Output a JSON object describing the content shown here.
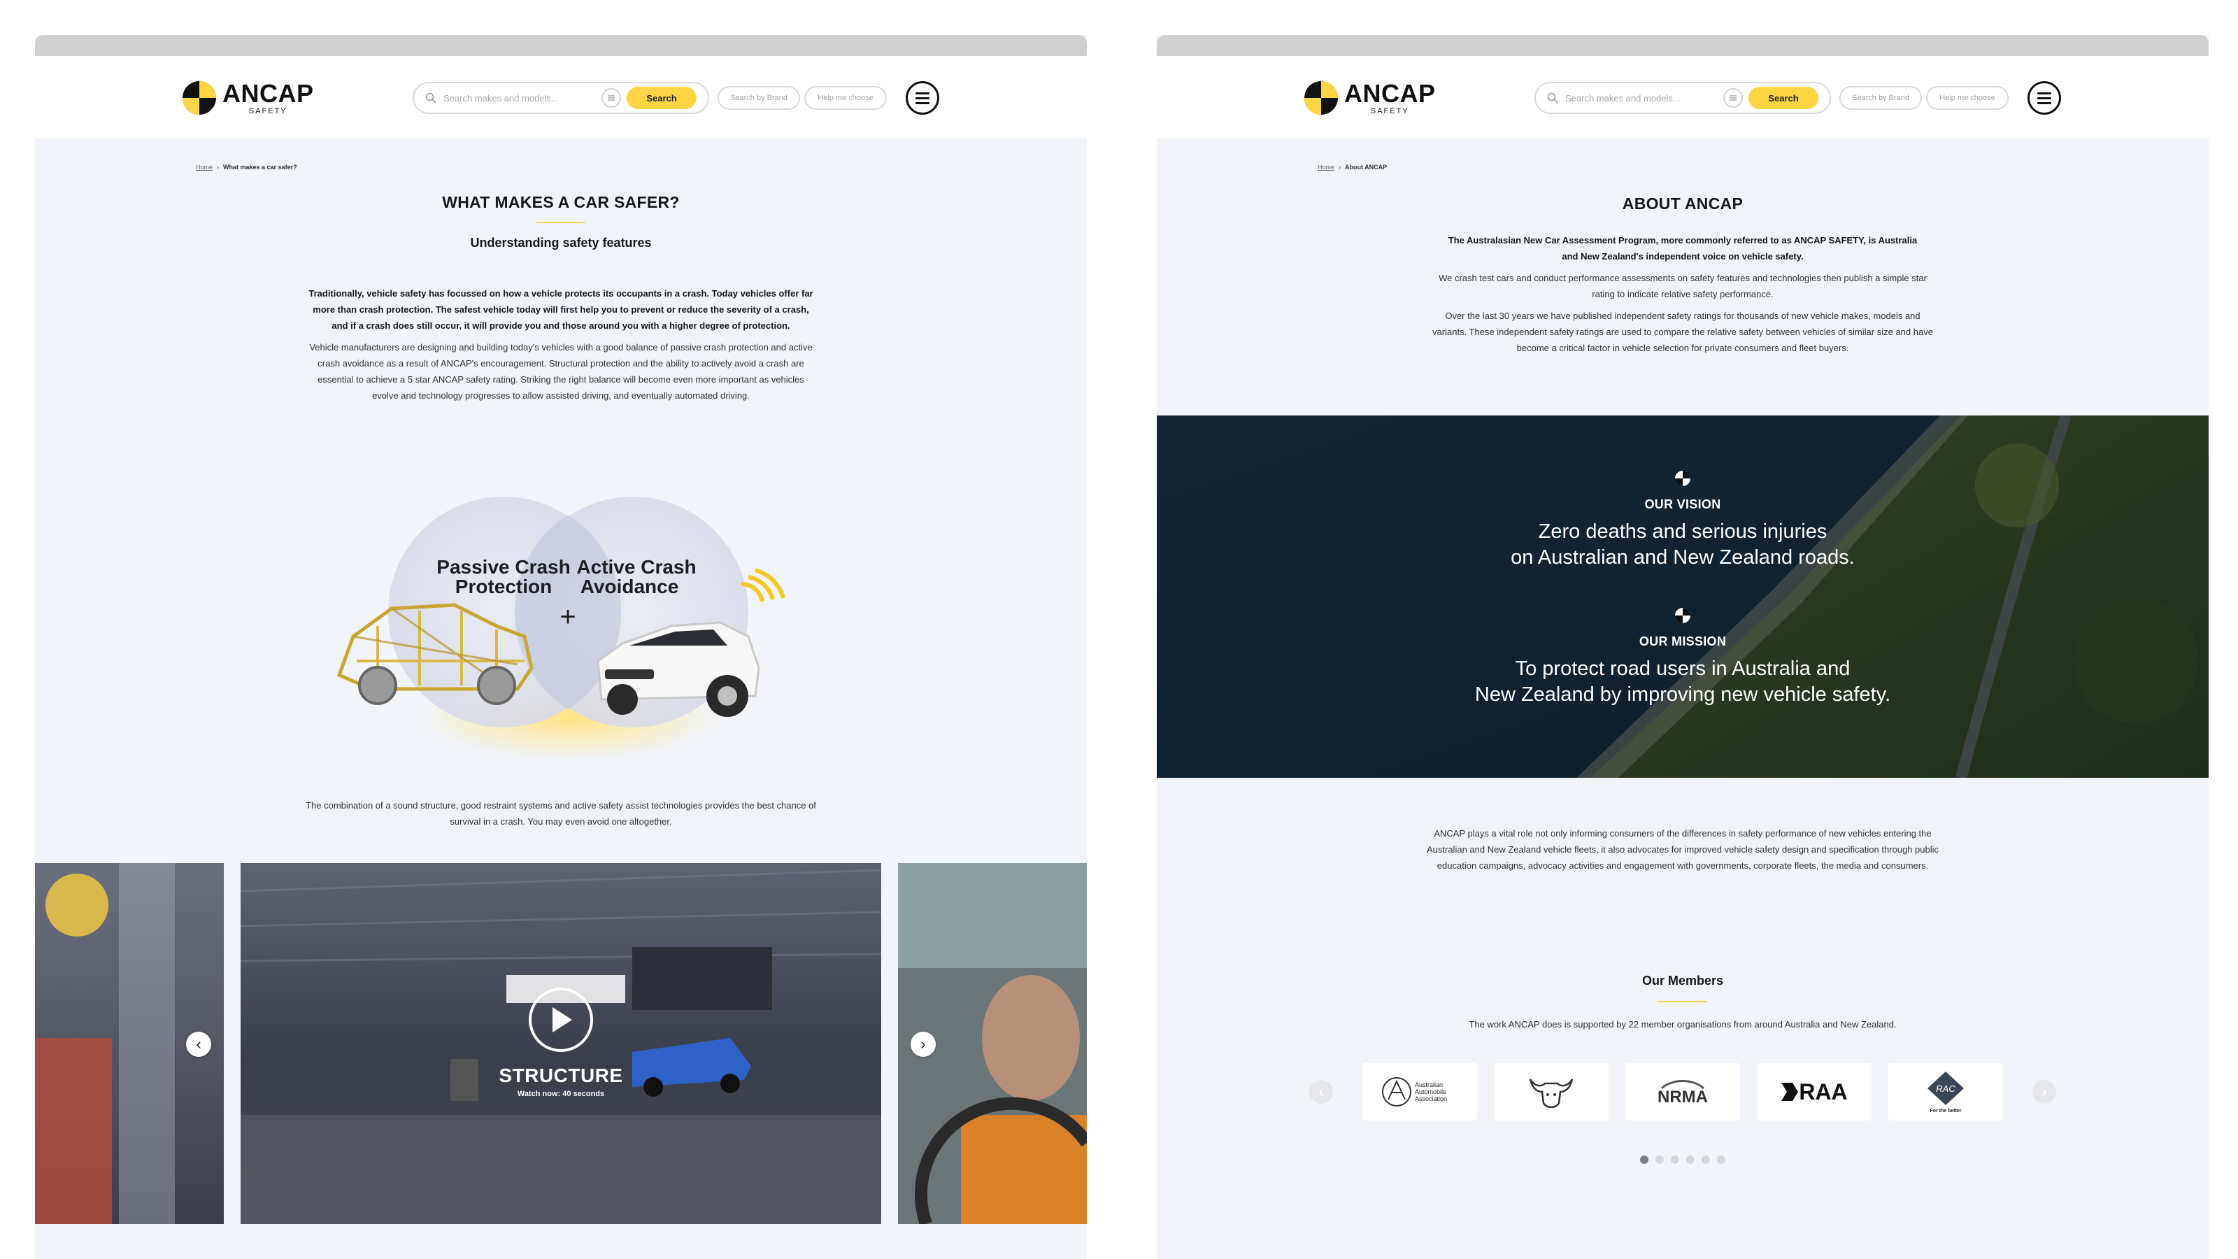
{
  "brand": {
    "name": "ANCAP",
    "sub": "SAFETY",
    "accent": "#ffd546"
  },
  "header": {
    "search_placeholder": "Search makes and models...",
    "search_button": "Search",
    "search_by_brand": "Search by Brand",
    "help_me_choose": "Help me choose"
  },
  "left_page": {
    "breadcrumb": {
      "home": "Home",
      "current": "What makes a car safer?"
    },
    "title": "WHAT MAKES A CAR SAFER?",
    "subtitle": "Understanding safety features",
    "intro_bold": "Traditionally, vehicle safety has focussed on how a vehicle protects its occupants in a crash. Today vehicles offer far more than crash protection. The safest vehicle today will first help you to prevent or reduce the severity of a crash, and if a crash does still occur, it will provide you and those around you with a higher degree of protection.",
    "intro_body": "Vehicle manufacturers are designing and building today's vehicles with a good balance of passive crash protection and active crash avoidance as a result of ANCAP's encouragement. Structural protection and the ability to actively avoid a crash are essential to achieve a 5 star ANCAP safety rating. Striking the right balance will become even more important as vehicles evolve and technology progresses to allow assisted driving, and eventually automated driving.",
    "venn": {
      "left_line1": "Passive Crash",
      "left_line2": "Protection",
      "plus": "+",
      "right_line1": "Active Crash",
      "right_line2": "Avoidance"
    },
    "combination_text": "The combination of a sound structure, good restraint systems and active safety assist technologies provides the best chance of survival in a crash. You may even avoid one altogether.",
    "video": {
      "title": "STRUCTURE",
      "duration": "Watch now: 40 seconds"
    }
  },
  "right_page": {
    "breadcrumb": {
      "home": "Home",
      "current": "About ANCAP"
    },
    "title": "ABOUT ANCAP",
    "intro_bold": "The Australasian New Car Assessment Program, more commonly referred to as ANCAP SAFETY, is Australia and New Zealand's independent voice on vehicle safety.",
    "p1": "We crash test cars and conduct performance assessments on safety features and technologies then publish a simple star rating to indicate relative safety performance.",
    "p2": "Over the last 30 years we have published independent safety ratings for thousands of new vehicle makes, models and variants. These independent safety ratings are used to compare the relative safety between vehicles of similar size and have become a critical factor in vehicle selection for private consumers and fleet buyers.",
    "vision_label": "OUR VISION",
    "vision_line1": "Zero deaths and serious injuries",
    "vision_line2": "on Australian and New Zealand roads.",
    "mission_label": "OUR MISSION",
    "mission_line1": "To protect road users in Australia and",
    "mission_line2": "New Zealand by improving new vehicle safety.",
    "role_text": "ANCAP plays a vital role not only informing consumers of the differences in safety performance of new vehicles entering the Australian and New Zealand vehicle fleets, it also advocates for improved vehicle safety design and specification through public education campaigns, advocacy activities and engagement with governments, corporate fleets, the media and consumers.",
    "members_title": "Our Members",
    "members_text": "The work ANCAP does is supported by 22 member organisations from around Australia and New Zealand.",
    "members": {
      "aaa_l1": "Australian",
      "aaa_l2": "Automobile",
      "aaa_l3": "Association",
      "nrma": "NRMA",
      "raa": "RAA",
      "rac": "RAC",
      "rac_tag": "For the better"
    }
  }
}
